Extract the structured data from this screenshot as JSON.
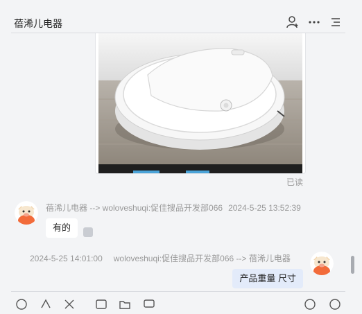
{
  "header": {
    "title": "蓓浠儿电器",
    "icons": [
      "user-add-icon",
      "more-icon",
      "menu-icon"
    ]
  },
  "chat": {
    "image_message": {
      "read_status": "已读",
      "image_subject": "robot vacuum cleaner"
    },
    "incoming_message": {
      "sender": "蓓浠儿电器 --> woloveshuqi:促佳搜品开发部066",
      "time": "2024-5-25 13:52:39",
      "text": "有的"
    },
    "outgoing_message": {
      "time": "2024-5-25 14:01:00",
      "sender": "woloveshuqi:促佳搜品开发部066 --> 蓓浠儿电器",
      "text": "产品重量 尺寸"
    }
  },
  "toolbar": {
    "icons": [
      "emoji-icon",
      "bell-icon",
      "scissors-icon",
      "image-icon",
      "folder-icon",
      "screen-icon",
      "history-icon",
      "help-icon"
    ]
  },
  "colors": {
    "background": "#f3f4f6",
    "outgoing_bubble": "#e3ebfa",
    "incoming_bubble": "#ffffff",
    "meta_text": "#999999"
  }
}
